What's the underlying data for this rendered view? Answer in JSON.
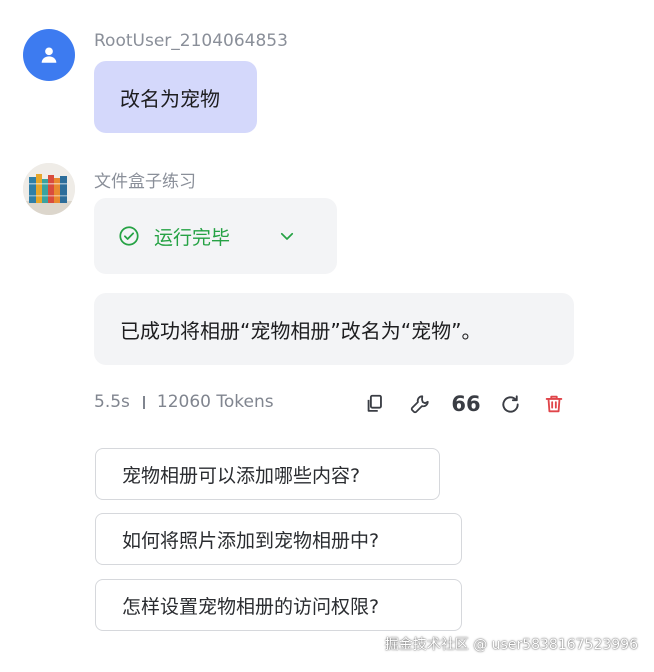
{
  "user_message": {
    "sender": "RootUser_2104064853",
    "text": "改名为宠物"
  },
  "bot_message": {
    "sender": "文件盒子练习",
    "status": "运行完毕",
    "reply": "已成功将相册“宠物相册”改名为“宠物”。",
    "duration": "5.5s",
    "tokens": "12060 Tokens",
    "quote_label": "66"
  },
  "suggestions": [
    "宠物相册可以添加哪些内容?",
    "如何将照片添加到宠物相册中?",
    "怎样设置宠物相册的访问权限?"
  ],
  "watermark": "掘金技术社区 @ user5838167523996",
  "colors": {
    "user_bubble": "#d4d8fb",
    "bot_bubble": "#f3f4f6",
    "status_green": "#25a244",
    "delete_red": "#e0454a",
    "user_avatar": "#3d7bf0"
  },
  "icons": {
    "user_avatar": "user-icon",
    "status": "check-circle-icon",
    "expand": "chevron-down-icon",
    "copy": "copy-icon",
    "wrench": "wrench-icon",
    "refresh": "refresh-icon",
    "delete": "trash-icon"
  }
}
